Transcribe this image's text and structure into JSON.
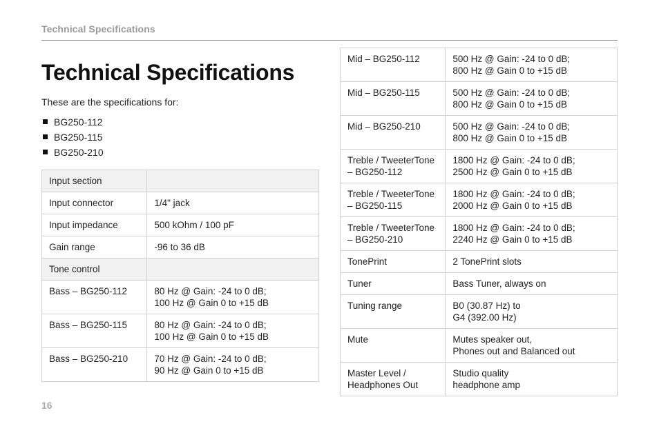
{
  "header": {
    "running": "Technical Specifications"
  },
  "title": "Technical Specifications",
  "intro": "These are the specifications for:",
  "models": [
    "BG250-112",
    "BG250-115",
    "BG250-210"
  ],
  "left_table": [
    {
      "section": true,
      "label": "Input section",
      "value": ""
    },
    {
      "label": "Input connector",
      "value": "1/4\" jack"
    },
    {
      "label": "Input impedance",
      "value": "500 kOhm / 100 pF"
    },
    {
      "label": "Gain range",
      "value": "-96 to 36 dB"
    },
    {
      "section": true,
      "label": "Tone control",
      "value": ""
    },
    {
      "label": "Bass – BG250-112",
      "value": "80 Hz @ Gain: -24 to 0 dB;\n100 Hz @ Gain 0 to +15 dB"
    },
    {
      "label": "Bass – BG250-115",
      "value": "80 Hz @ Gain: -24 to 0 dB;\n100 Hz @ Gain 0 to +15 dB"
    },
    {
      "label": "Bass – BG250-210",
      "value": "70 Hz @ Gain: -24 to 0 dB;\n90 Hz @ Gain 0 to +15 dB"
    }
  ],
  "right_table": [
    {
      "label": "Mid – BG250-112",
      "value": "500 Hz @ Gain: -24 to 0 dB;\n800 Hz @ Gain 0 to +15 dB"
    },
    {
      "label": "Mid – BG250-115",
      "value": "500 Hz @ Gain: -24 to 0 dB;\n800 Hz @ Gain 0 to +15 dB"
    },
    {
      "label": "Mid – BG250-210",
      "value": "500 Hz @ Gain: -24 to 0 dB;\n800 Hz @ Gain 0 to +15 dB"
    },
    {
      "label": "Treble / TweeterTone\n– BG250-112",
      "value": "1800 Hz @ Gain: -24 to 0 dB;\n2500 Hz @ Gain 0 to +15 dB"
    },
    {
      "label": "Treble / TweeterTone\n– BG250-115",
      "value": "1800 Hz @ Gain: -24 to 0 dB;\n2000 Hz @ Gain 0 to +15 dB"
    },
    {
      "label": "Treble / TweeterTone\n– BG250-210",
      "value": "1800 Hz @ Gain: -24 to 0 dB;\n2240 Hz @ Gain 0 to +15 dB"
    },
    {
      "label": "TonePrint",
      "value": "2 TonePrint slots"
    },
    {
      "label": "Tuner",
      "value": "Bass Tuner, always on"
    },
    {
      "label": "Tuning range",
      "value": "B0 (30.87 Hz) to\nG4 (392.00 Hz)"
    },
    {
      "label": "Mute",
      "value": "Mutes speaker out,\nPhones out and Balanced out"
    },
    {
      "label": "Master Level /\nHeadphones Out",
      "value": "Studio quality\nheadphone amp"
    }
  ],
  "page_number": "16"
}
